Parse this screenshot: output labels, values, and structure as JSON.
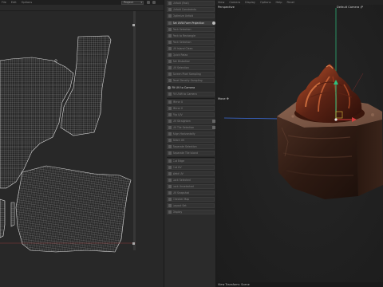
{
  "uv_editor": {
    "menu": [
      "File",
      "Edit",
      "Options"
    ],
    "dropdown_value": "Project"
  },
  "toolbox": {
    "items": [
      {
        "label": "Unfold (Fast)",
        "state": "normal"
      },
      {
        "label": "Unfold Constraints",
        "state": "normal"
      },
      {
        "label": "Optimize Unfold",
        "state": "normal"
      },
      {
        "label": "Set UVW Form Projection",
        "state": "active"
      },
      {
        "label": "Pack Selection",
        "state": "normal"
      },
      {
        "label": "Pack to Rectangle",
        "state": "normal"
      },
      {
        "label": "Pack Selection",
        "state": "normal"
      },
      {
        "label": "UV Island Clean",
        "state": "normal"
      },
      {
        "label": "Quick Relax",
        "state": "normal"
      },
      {
        "label": "Set Distortion",
        "state": "normal"
      },
      {
        "label": "UV Selection",
        "state": "normal"
      },
      {
        "label": "Screen Pixel Sampling",
        "state": "normal"
      },
      {
        "label": "Texel Density Sampling",
        "state": "normal"
      },
      {
        "label": "Fit UV to Camera",
        "state": "section"
      },
      {
        "label": "Fit UVW to Camera",
        "state": "normal"
      },
      {
        "label": "Mirror U",
        "state": "normal"
      },
      {
        "label": "Mirror V",
        "state": "normal"
      },
      {
        "label": "Flip U/V",
        "state": "normal"
      },
      {
        "label": "UV Straighten",
        "state": "normal"
      },
      {
        "label": "UV Tile Selection",
        "state": "normal"
      },
      {
        "label": "Align Horizontally",
        "state": "normal"
      },
      {
        "label": "Stitch UV",
        "state": "normal"
      },
      {
        "label": "Separate Selection",
        "state": "normal"
      },
      {
        "label": "Separate Tile Island",
        "state": "normal"
      },
      {
        "label": "Cut Edge",
        "state": "normal"
      },
      {
        "label": "Cut UV",
        "state": "normal"
      },
      {
        "label": "Weld UV",
        "state": "normal"
      },
      {
        "label": "Lock Selected",
        "state": "normal"
      },
      {
        "label": "Lock Unselected",
        "state": "normal"
      },
      {
        "label": "UV Snapshot",
        "state": "normal"
      },
      {
        "label": "Checker Map",
        "state": "normal"
      },
      {
        "label": "Layout Set",
        "state": "normal"
      },
      {
        "label": "Display",
        "state": "normal"
      }
    ]
  },
  "viewport3d": {
    "menu": [
      "View",
      "Camera",
      "Display",
      "Options",
      "Help",
      "Panel"
    ],
    "label_perspective": "Perspective",
    "label_camera": "Default Camera (P",
    "label_move": "Move",
    "status": "View Transform: Scene"
  },
  "colors": {
    "axis_y": "#2ec27e",
    "axis_x": "#3b6bd6",
    "axis_red": "#d43c3c",
    "uv_grid_line": "#cfcfcf"
  }
}
